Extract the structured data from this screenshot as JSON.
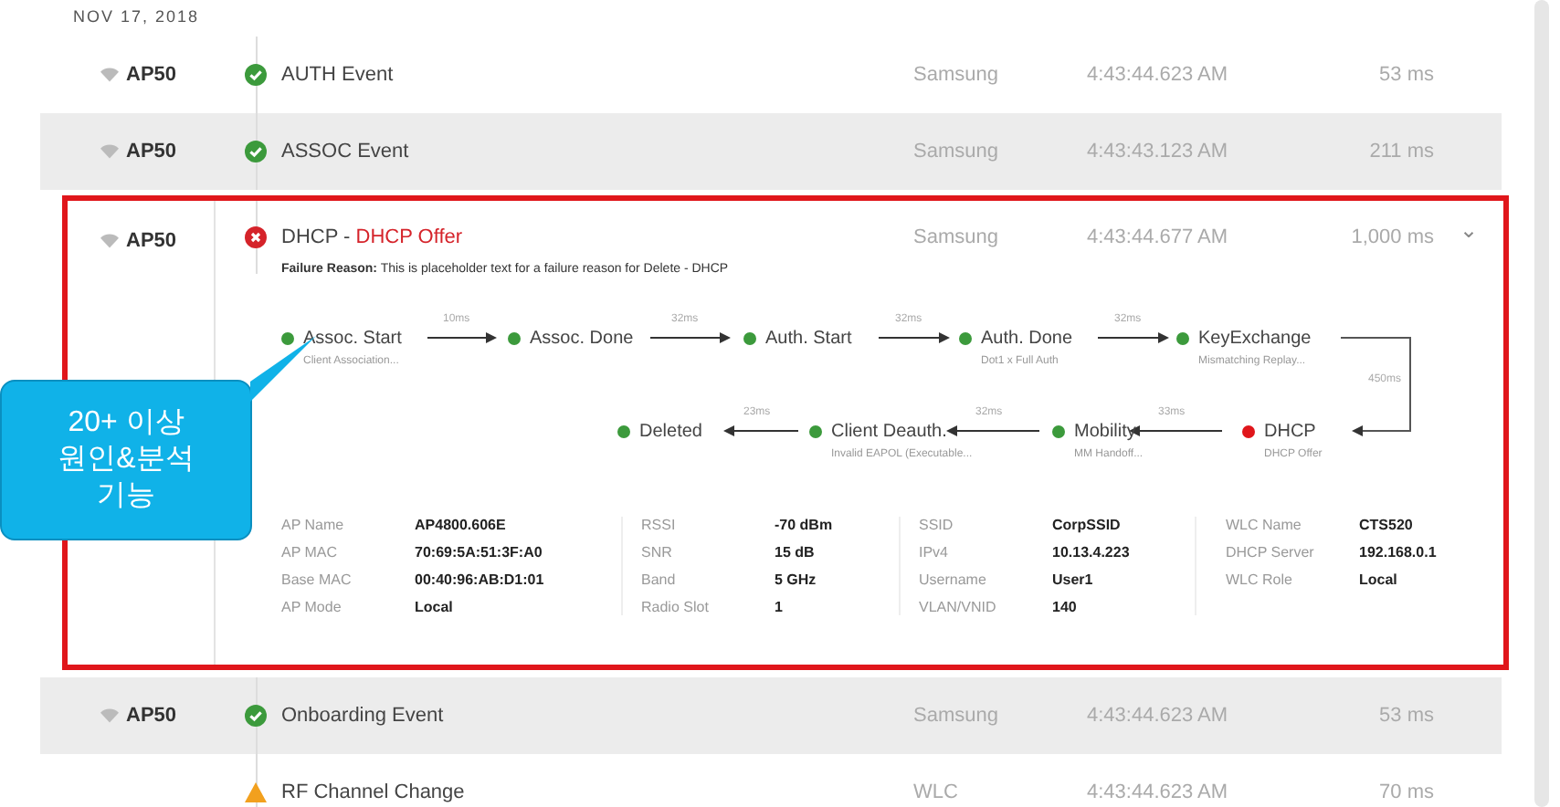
{
  "date_header": "NOV 17, 2018",
  "events": [
    {
      "ap": "AP50",
      "kind": "success",
      "name": "AUTH Event",
      "source": "Samsung",
      "time": "4:43:44.623 AM",
      "duration": "53 ms",
      "shaded": false,
      "expanded": false
    },
    {
      "ap": "AP50",
      "kind": "success",
      "name": "ASSOC Event",
      "source": "Samsung",
      "time": "4:43:43.123 AM",
      "duration": "211 ms",
      "shaded": true,
      "expanded": false
    },
    {
      "ap": "AP50",
      "kind": "error",
      "name": "DHCP - ",
      "name_detail": "DHCP Offer",
      "source": "Samsung",
      "time": "4:43:44.677 AM",
      "duration": "1,000 ms",
      "expanded": true,
      "chevron": "⌄",
      "failure_label": "Failure Reason:",
      "failure_text": "This is placeholder text for a failure reason for Delete - DHCP",
      "steps": [
        {
          "name": "Assoc. Start",
          "detail": "Client Association...",
          "color": "#3c9a3c"
        },
        {
          "name": "Assoc. Done",
          "color": "#3c9a3c"
        },
        {
          "name": "Auth. Start",
          "color": "#3c9a3c"
        },
        {
          "name": "Auth. Done",
          "detail": "Dot1 x Full Auth",
          "color": "#3c9a3c"
        },
        {
          "name": "KeyExchange",
          "detail": "Mismatching Replay...",
          "color": "#3c9a3c"
        },
        {
          "name": "Deleted",
          "color": "#3c9a3c"
        },
        {
          "name": "Client Deauth.",
          "detail": "Invalid EAPOL (Executable...",
          "color": "#3c9a3c"
        },
        {
          "name": "Mobility",
          "detail": "MM Handoff...",
          "color": "#3c9a3c"
        },
        {
          "name": "DHCP",
          "detail": "DHCP Offer",
          "color": "#e0161b"
        }
      ],
      "transitions": [
        "10ms",
        "32ms",
        "32ms",
        "32ms",
        "450ms",
        "23ms",
        "32ms",
        "33ms"
      ],
      "details": [
        [
          {
            "label": "AP Name",
            "value": "AP4800.606E"
          },
          {
            "label": "AP MAC",
            "value": "70:69:5A:51:3F:A0"
          },
          {
            "label": "Base MAC",
            "value": "00:40:96:AB:D1:01"
          },
          {
            "label": "AP Mode",
            "value": "Local"
          }
        ],
        [
          {
            "label": "RSSI",
            "value": "-70 dBm"
          },
          {
            "label": "SNR",
            "value": "15 dB"
          },
          {
            "label": "Band",
            "value": "5 GHz"
          },
          {
            "label": "Radio Slot",
            "value": "1"
          }
        ],
        [
          {
            "label": "SSID",
            "value": "CorpSSID"
          },
          {
            "label": "IPv4",
            "value": "10.13.4.223"
          },
          {
            "label": "Username",
            "value": "User1"
          },
          {
            "label": "VLAN/VNID",
            "value": "140"
          }
        ],
        [
          {
            "label": "WLC Name",
            "value": "CTS520"
          },
          {
            "label": "DHCP Server",
            "value": "192.168.0.1"
          },
          {
            "label": "WLC Role",
            "value": "Local"
          }
        ]
      ]
    },
    {
      "ap": "AP50",
      "kind": "success",
      "name": "Onboarding Event",
      "source": "Samsung",
      "time": "4:43:44.623 AM",
      "duration": "53 ms",
      "shaded": true,
      "expanded": false
    },
    {
      "kind": "warning",
      "name": "RF Channel Change",
      "source": "WLC",
      "time": "4:43:44.623 AM",
      "duration": "70 ms",
      "shaded": false,
      "expanded": false
    }
  ],
  "callout": "20+ 이상\n원인&분석\n기능"
}
